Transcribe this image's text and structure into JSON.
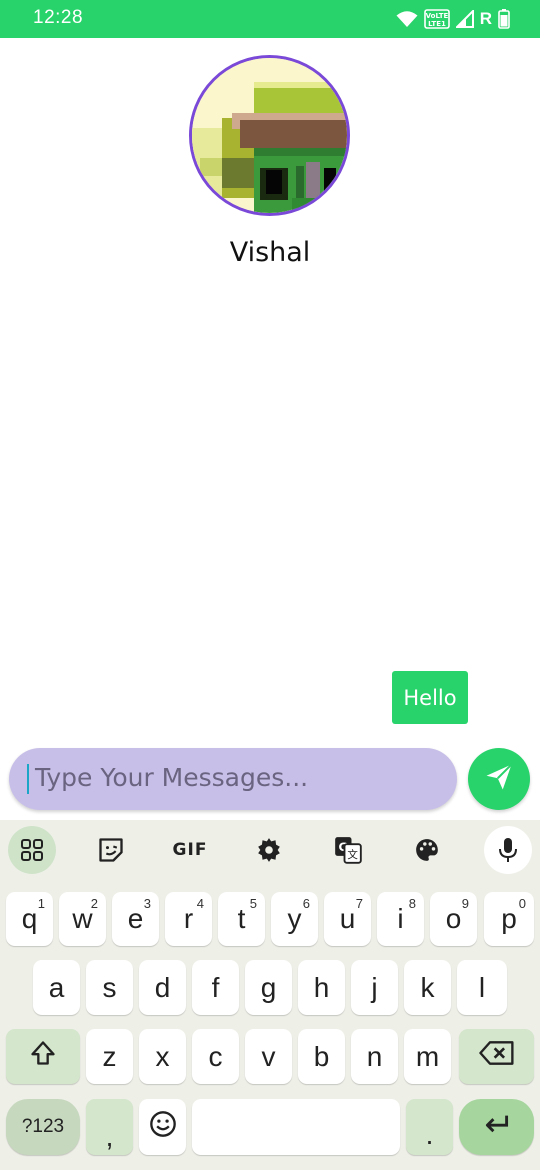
{
  "status_bar": {
    "time": "12:28",
    "network_badge": "VoLTE1",
    "roaming_indicator": "R",
    "icons": [
      "wifi-icon",
      "volte-icon",
      "signal-icon",
      "battery-icon"
    ]
  },
  "profile": {
    "name": "Vishal",
    "avatar_icon": "pixel-art-avatar"
  },
  "messages": [
    {
      "text": "Hello",
      "direction": "outgoing"
    }
  ],
  "composer": {
    "placeholder": "Type Your Messages...",
    "send_icon": "send-icon"
  },
  "keyboard": {
    "toolbar": {
      "gif_label": "GIF",
      "icons": [
        "apps-grid-icon",
        "sticker-icon",
        "gif-icon",
        "settings-icon",
        "translate-icon",
        "palette-icon",
        "mic-icon"
      ]
    },
    "row1": [
      {
        "key": "q",
        "hint": "1"
      },
      {
        "key": "w",
        "hint": "2"
      },
      {
        "key": "e",
        "hint": "3"
      },
      {
        "key": "r",
        "hint": "4"
      },
      {
        "key": "t",
        "hint": "5"
      },
      {
        "key": "y",
        "hint": "6"
      },
      {
        "key": "u",
        "hint": "7"
      },
      {
        "key": "i",
        "hint": "8"
      },
      {
        "key": "o",
        "hint": "9"
      },
      {
        "key": "p",
        "hint": "0"
      }
    ],
    "row2": [
      "a",
      "s",
      "d",
      "f",
      "g",
      "h",
      "j",
      "k",
      "l"
    ],
    "row3": [
      "z",
      "x",
      "c",
      "v",
      "b",
      "n",
      "m"
    ],
    "symbols_label": "?123",
    "comma_label": ",",
    "period_label": ".",
    "colors": {
      "background": "#eef0e8",
      "modifier": "#d4e6cc",
      "enter": "#a6d69e"
    }
  },
  "colors": {
    "accent": "#28d36b",
    "composer_bg": "#c8bfe8",
    "avatar_border": "#7a49d7"
  }
}
